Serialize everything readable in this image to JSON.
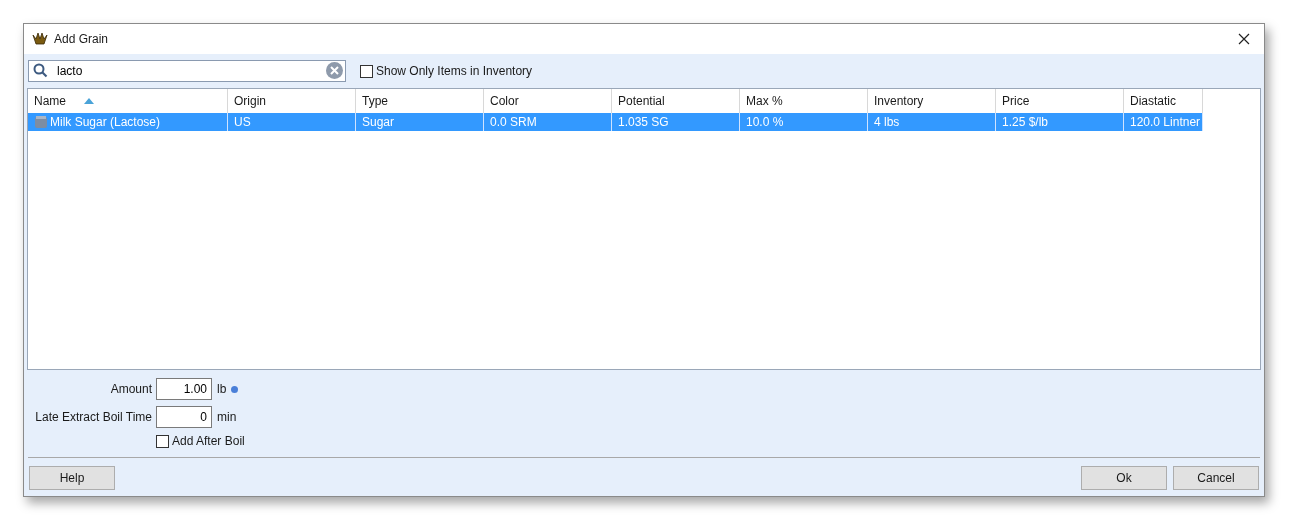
{
  "window": {
    "title": "Add Grain"
  },
  "search": {
    "value": "lacto"
  },
  "inventory_filter": {
    "label": "Show Only Items in Inventory",
    "checked": false
  },
  "table": {
    "columns": [
      {
        "label": "Name",
        "sorted": true
      },
      {
        "label": "Origin",
        "sorted": false
      },
      {
        "label": "Type",
        "sorted": false
      },
      {
        "label": "Color",
        "sorted": false
      },
      {
        "label": "Potential",
        "sorted": false
      },
      {
        "label": "Max %",
        "sorted": false
      },
      {
        "label": "Inventory",
        "sorted": false
      },
      {
        "label": "Price",
        "sorted": false
      },
      {
        "label": "Diastatic",
        "sorted": false
      }
    ],
    "rows": [
      {
        "selected": true,
        "cells": [
          "Milk Sugar (Lactose)",
          "US",
          "Sugar",
          "0.0 SRM",
          "1.035 SG",
          "10.0 %",
          "4 lbs",
          "1.25 $/lb",
          "120.0 Lintner"
        ]
      }
    ]
  },
  "amount": {
    "label": "Amount",
    "value": "1.00",
    "unit": "lb"
  },
  "boil_time": {
    "label": "Late Extract Boil Time",
    "value": "0",
    "unit": "min"
  },
  "add_after_boil": {
    "label": "Add After Boil",
    "checked": false
  },
  "buttons": {
    "help": "Help",
    "ok": "Ok",
    "cancel": "Cancel"
  }
}
